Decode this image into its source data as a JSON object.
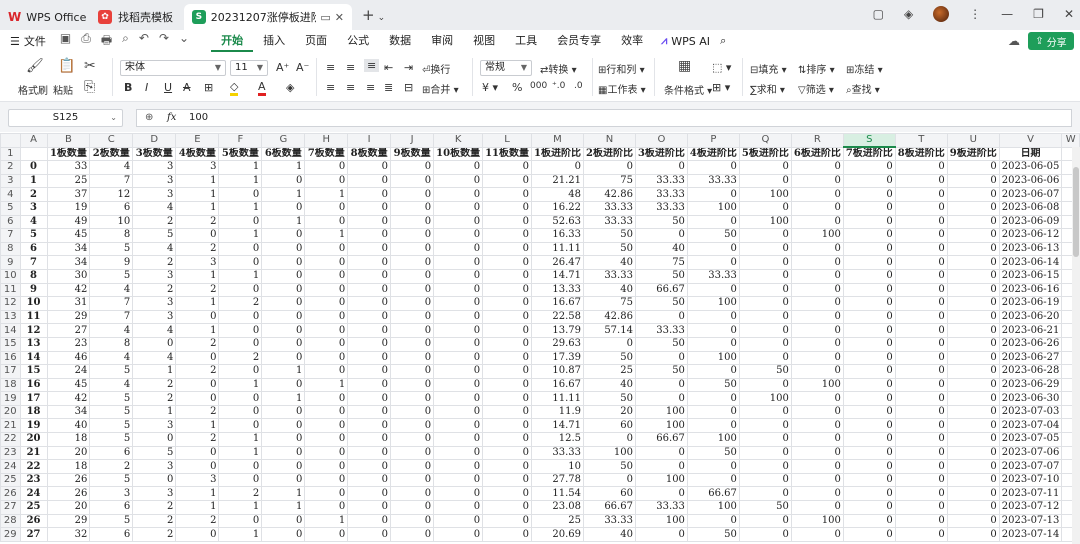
{
  "titlebar": {
    "app_tab": "WPS Office",
    "template_tab": "找稻壳模板",
    "file_tab": "20231207涨停板进阶统计.xlsx",
    "new_tab_symbol": "+"
  },
  "menubar": {
    "file_label": "文件",
    "items": [
      "开始",
      "插入",
      "页面",
      "公式",
      "数据",
      "审阅",
      "视图",
      "工具",
      "会员专享",
      "效率"
    ],
    "active": "开始",
    "ai_label": "WPS AI",
    "share_label": "分享"
  },
  "ribbon": {
    "format_painter": "格式刷",
    "paste": "粘贴",
    "font_name": "宋体",
    "font_size": "11",
    "wrap": "换行",
    "merge": "合并",
    "number_format": "常规",
    "convert": "转换",
    "rows_cols": "行和列",
    "worksheet": "工作表",
    "cond_format": "条件格式",
    "fill": "填充",
    "sort": "排序",
    "freeze": "冻结",
    "sum": "求和",
    "filter": "筛选",
    "find": "查找"
  },
  "formula_bar": {
    "cell_ref": "S125",
    "fx_label": "fx",
    "value": "100"
  },
  "sheet": {
    "columns": [
      "A",
      "B",
      "C",
      "D",
      "E",
      "F",
      "G",
      "H",
      "I",
      "J",
      "K",
      "L",
      "M",
      "N",
      "O",
      "P",
      "Q",
      "R",
      "S",
      "T",
      "U",
      "V",
      "W"
    ],
    "selected_column": "S",
    "header_row": [
      "",
      "1板数量",
      "2板数量",
      "3板数量",
      "4板数量",
      "5板数量",
      "6板数量",
      "7板数量",
      "8板数量",
      "9板数量",
      "10板数量",
      "11板数量",
      "1板进阶比",
      "2板进阶比",
      "3板进阶比",
      "4板进阶比",
      "5板进阶比",
      "6板进阶比",
      "7板进阶比",
      "8板进阶比",
      "9板进阶比",
      "日期",
      ""
    ],
    "rows": [
      [
        "0",
        "33",
        "4",
        "3",
        "3",
        "1",
        "1",
        "0",
        "0",
        "0",
        "0",
        "0",
        "0",
        "0",
        "0",
        "0",
        "0",
        "0",
        "0",
        "0",
        "0",
        "2023-06-05"
      ],
      [
        "1",
        "25",
        "7",
        "3",
        "1",
        "1",
        "0",
        "0",
        "0",
        "0",
        "0",
        "0",
        "21.21",
        "75",
        "33.33",
        "33.33",
        "0",
        "0",
        "0",
        "0",
        "0",
        "2023-06-06"
      ],
      [
        "2",
        "37",
        "12",
        "3",
        "1",
        "0",
        "1",
        "1",
        "0",
        "0",
        "0",
        "0",
        "48",
        "42.86",
        "33.33",
        "0",
        "100",
        "0",
        "0",
        "0",
        "0",
        "2023-06-07"
      ],
      [
        "3",
        "19",
        "6",
        "4",
        "1",
        "1",
        "0",
        "0",
        "0",
        "0",
        "0",
        "0",
        "16.22",
        "33.33",
        "33.33",
        "100",
        "0",
        "0",
        "0",
        "0",
        "0",
        "2023-06-08"
      ],
      [
        "4",
        "49",
        "10",
        "2",
        "2",
        "0",
        "1",
        "0",
        "0",
        "0",
        "0",
        "0",
        "52.63",
        "33.33",
        "50",
        "0",
        "100",
        "0",
        "0",
        "0",
        "0",
        "2023-06-09"
      ],
      [
        "5",
        "45",
        "8",
        "5",
        "0",
        "1",
        "0",
        "1",
        "0",
        "0",
        "0",
        "0",
        "16.33",
        "50",
        "0",
        "50",
        "0",
        "100",
        "0",
        "0",
        "0",
        "2023-06-12"
      ],
      [
        "6",
        "34",
        "5",
        "4",
        "2",
        "0",
        "0",
        "0",
        "0",
        "0",
        "0",
        "0",
        "11.11",
        "50",
        "40",
        "0",
        "0",
        "0",
        "0",
        "0",
        "0",
        "2023-06-13"
      ],
      [
        "7",
        "34",
        "9",
        "2",
        "3",
        "0",
        "0",
        "0",
        "0",
        "0",
        "0",
        "0",
        "26.47",
        "40",
        "75",
        "0",
        "0",
        "0",
        "0",
        "0",
        "0",
        "2023-06-14"
      ],
      [
        "8",
        "30",
        "5",
        "3",
        "1",
        "1",
        "0",
        "0",
        "0",
        "0",
        "0",
        "0",
        "14.71",
        "33.33",
        "50",
        "33.33",
        "0",
        "0",
        "0",
        "0",
        "0",
        "2023-06-15"
      ],
      [
        "9",
        "42",
        "4",
        "2",
        "2",
        "0",
        "0",
        "0",
        "0",
        "0",
        "0",
        "0",
        "13.33",
        "40",
        "66.67",
        "0",
        "0",
        "0",
        "0",
        "0",
        "0",
        "2023-06-16"
      ],
      [
        "10",
        "31",
        "7",
        "3",
        "1",
        "2",
        "0",
        "0",
        "0",
        "0",
        "0",
        "0",
        "16.67",
        "75",
        "50",
        "100",
        "0",
        "0",
        "0",
        "0",
        "0",
        "2023-06-19"
      ],
      [
        "11",
        "29",
        "7",
        "3",
        "0",
        "0",
        "0",
        "0",
        "0",
        "0",
        "0",
        "0",
        "22.58",
        "42.86",
        "0",
        "0",
        "0",
        "0",
        "0",
        "0",
        "0",
        "2023-06-20"
      ],
      [
        "12",
        "27",
        "4",
        "4",
        "1",
        "0",
        "0",
        "0",
        "0",
        "0",
        "0",
        "0",
        "13.79",
        "57.14",
        "33.33",
        "0",
        "0",
        "0",
        "0",
        "0",
        "0",
        "2023-06-21"
      ],
      [
        "13",
        "23",
        "8",
        "0",
        "2",
        "0",
        "0",
        "0",
        "0",
        "0",
        "0",
        "0",
        "29.63",
        "0",
        "50",
        "0",
        "0",
        "0",
        "0",
        "0",
        "0",
        "2023-06-26"
      ],
      [
        "14",
        "46",
        "4",
        "4",
        "0",
        "2",
        "0",
        "0",
        "0",
        "0",
        "0",
        "0",
        "17.39",
        "50",
        "0",
        "100",
        "0",
        "0",
        "0",
        "0",
        "0",
        "2023-06-27"
      ],
      [
        "15",
        "24",
        "5",
        "1",
        "2",
        "0",
        "1",
        "0",
        "0",
        "0",
        "0",
        "0",
        "10.87",
        "25",
        "50",
        "0",
        "50",
        "0",
        "0",
        "0",
        "0",
        "2023-06-28"
      ],
      [
        "16",
        "45",
        "4",
        "2",
        "0",
        "1",
        "0",
        "1",
        "0",
        "0",
        "0",
        "0",
        "16.67",
        "40",
        "0",
        "50",
        "0",
        "100",
        "0",
        "0",
        "0",
        "2023-06-29"
      ],
      [
        "17",
        "42",
        "5",
        "2",
        "0",
        "0",
        "1",
        "0",
        "0",
        "0",
        "0",
        "0",
        "11.11",
        "50",
        "0",
        "0",
        "100",
        "0",
        "0",
        "0",
        "0",
        "2023-06-30"
      ],
      [
        "18",
        "34",
        "5",
        "1",
        "2",
        "0",
        "0",
        "0",
        "0",
        "0",
        "0",
        "0",
        "11.9",
        "20",
        "100",
        "0",
        "0",
        "0",
        "0",
        "0",
        "0",
        "2023-07-03"
      ],
      [
        "19",
        "40",
        "5",
        "3",
        "1",
        "0",
        "0",
        "0",
        "0",
        "0",
        "0",
        "0",
        "14.71",
        "60",
        "100",
        "0",
        "0",
        "0",
        "0",
        "0",
        "0",
        "2023-07-04"
      ],
      [
        "20",
        "18",
        "5",
        "0",
        "2",
        "1",
        "0",
        "0",
        "0",
        "0",
        "0",
        "0",
        "12.5",
        "0",
        "66.67",
        "100",
        "0",
        "0",
        "0",
        "0",
        "0",
        "2023-07-05"
      ],
      [
        "21",
        "20",
        "6",
        "5",
        "0",
        "1",
        "0",
        "0",
        "0",
        "0",
        "0",
        "0",
        "33.33",
        "100",
        "0",
        "50",
        "0",
        "0",
        "0",
        "0",
        "0",
        "2023-07-06"
      ],
      [
        "22",
        "18",
        "2",
        "3",
        "0",
        "0",
        "0",
        "0",
        "0",
        "0",
        "0",
        "0",
        "10",
        "50",
        "0",
        "0",
        "0",
        "0",
        "0",
        "0",
        "0",
        "2023-07-07"
      ],
      [
        "23",
        "26",
        "5",
        "0",
        "3",
        "0",
        "0",
        "0",
        "0",
        "0",
        "0",
        "0",
        "27.78",
        "0",
        "100",
        "0",
        "0",
        "0",
        "0",
        "0",
        "0",
        "2023-07-10"
      ],
      [
        "24",
        "26",
        "3",
        "3",
        "1",
        "2",
        "1",
        "0",
        "0",
        "0",
        "0",
        "0",
        "11.54",
        "60",
        "0",
        "66.67",
        "0",
        "0",
        "0",
        "0",
        "0",
        "2023-07-11"
      ],
      [
        "25",
        "20",
        "6",
        "2",
        "1",
        "1",
        "1",
        "0",
        "0",
        "0",
        "0",
        "0",
        "23.08",
        "66.67",
        "33.33",
        "100",
        "50",
        "0",
        "0",
        "0",
        "0",
        "2023-07-12"
      ],
      [
        "26",
        "29",
        "5",
        "2",
        "2",
        "0",
        "0",
        "1",
        "0",
        "0",
        "0",
        "0",
        "25",
        "33.33",
        "100",
        "0",
        "0",
        "100",
        "0",
        "0",
        "0",
        "2023-07-13"
      ],
      [
        "27",
        "32",
        "6",
        "2",
        "0",
        "1",
        "0",
        "0",
        "0",
        "0",
        "0",
        "0",
        "20.69",
        "40",
        "0",
        "50",
        "0",
        "0",
        "0",
        "0",
        "0",
        "2023-07-14"
      ]
    ]
  }
}
